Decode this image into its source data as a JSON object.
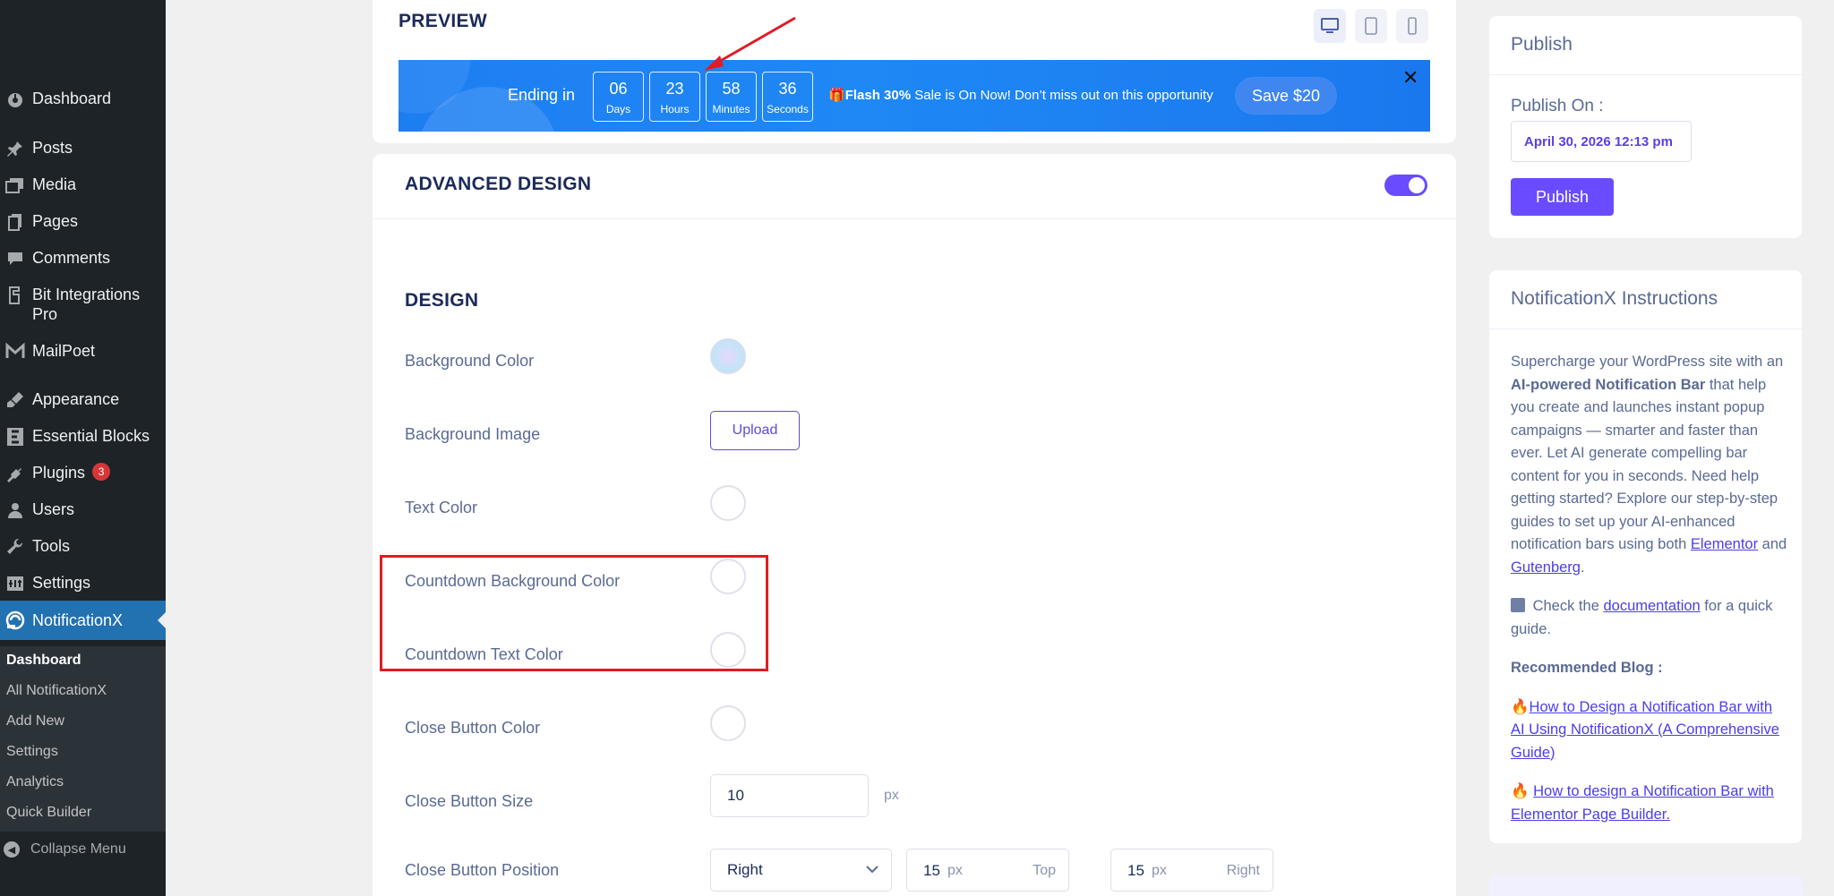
{
  "sidebar": {
    "items": [
      {
        "label": "Dashboard",
        "icon": "dashboard-icon"
      },
      {
        "label": "Posts",
        "icon": "pin-icon"
      },
      {
        "label": "Media",
        "icon": "media-icon"
      },
      {
        "label": "Pages",
        "icon": "pages-icon"
      },
      {
        "label": "Comments",
        "icon": "comments-icon"
      },
      {
        "label": "Bit Integrations Pro",
        "icon": "bit-integrations-icon"
      },
      {
        "label": "MailPoet",
        "icon": "mailpoet-icon"
      },
      {
        "label": "Appearance",
        "icon": "brush-icon"
      },
      {
        "label": "Essential Blocks",
        "icon": "essential-blocks-icon"
      },
      {
        "label": "Plugins",
        "icon": "plugins-icon",
        "badge": "3"
      },
      {
        "label": "Users",
        "icon": "users-icon"
      },
      {
        "label": "Tools",
        "icon": "wrench-icon"
      },
      {
        "label": "Settings",
        "icon": "settings-icon"
      },
      {
        "label": "NotificationX",
        "icon": "notificationx-icon",
        "active": true
      }
    ],
    "submenu": [
      "Dashboard",
      "All NotificationX",
      "Add New",
      "Settings",
      "Analytics",
      "Quick Builder"
    ],
    "collapse_label": "Collapse Menu"
  },
  "preview": {
    "title": "PREVIEW",
    "bar": {
      "ending_in": "Ending in",
      "countdown": [
        {
          "value": "06",
          "unit": "Days"
        },
        {
          "value": "23",
          "unit": "Hours"
        },
        {
          "value": "58",
          "unit": "Minutes"
        },
        {
          "value": "36",
          "unit": "Seconds"
        }
      ],
      "gift": "🎁",
      "flash_bold": "Flash 30%",
      "flash_rest": " Sale is On Now! Don’t miss out on this opportunity",
      "cta": "Save $20",
      "close": "✕"
    }
  },
  "advanced": {
    "title": "ADVANCED DESIGN",
    "toggle_on": true,
    "design_title": "DESIGN",
    "fields": {
      "background_color": "Background Color",
      "background_image": "Background Image",
      "upload": "Upload",
      "text_color": "Text Color",
      "countdown_bg_color": "Countdown Background Color",
      "countdown_text_color": "Countdown Text Color",
      "close_button_color": "Close Button Color",
      "close_button_size": "Close Button Size",
      "close_button_size_value": "10",
      "close_button_size_unit": "px",
      "close_button_position": "Close Button Position",
      "position_value": "Right",
      "offset_top_value": "15",
      "offset_top_unit": "px",
      "offset_top_label": "Top",
      "offset_right_value": "15",
      "offset_right_unit": "px",
      "offset_right_label": "Right"
    }
  },
  "publish": {
    "title": "Publish",
    "publish_on_label": "Publish On :",
    "date": "April 30, 2026 12:13 pm",
    "button": "Publish"
  },
  "instructions": {
    "title": "NotificationX Instructions",
    "p1_a": "Supercharge your WordPress site with an ",
    "p1_bold": "AI-powered Notification Bar",
    "p1_b": " that help you create and launches instant popup campaigns — smarter and faster than ever. Let AI generate compelling bar content for you in seconds. Need help getting started? Explore our step-by-step guides to set up your AI-enhanced notification bars using both ",
    "link_elementor": "Elementor",
    "and": " and ",
    "link_gutenberg": "Gutenberg",
    "period": ".",
    "p2_a": " Check the ",
    "link_documentation": "documentation",
    "p2_b": " for a quick guide.",
    "recommended": "Recommended Blog :",
    "blog1_emoji": "🔥",
    "blog1": "How to Design a Notification Bar with AI Using NotificationX (A Comprehensive Guide)",
    "blog2_emoji": "🔥 ",
    "blog2": "How to design a Notification Bar with Elementor Page Builder."
  },
  "colors": {
    "wp_sidebar": "#1d2327",
    "wp_active": "#2271b1",
    "accent_purple": "#6a4bff",
    "bar_blue": "#1f88f5",
    "annotation_red": "#e11b22"
  }
}
